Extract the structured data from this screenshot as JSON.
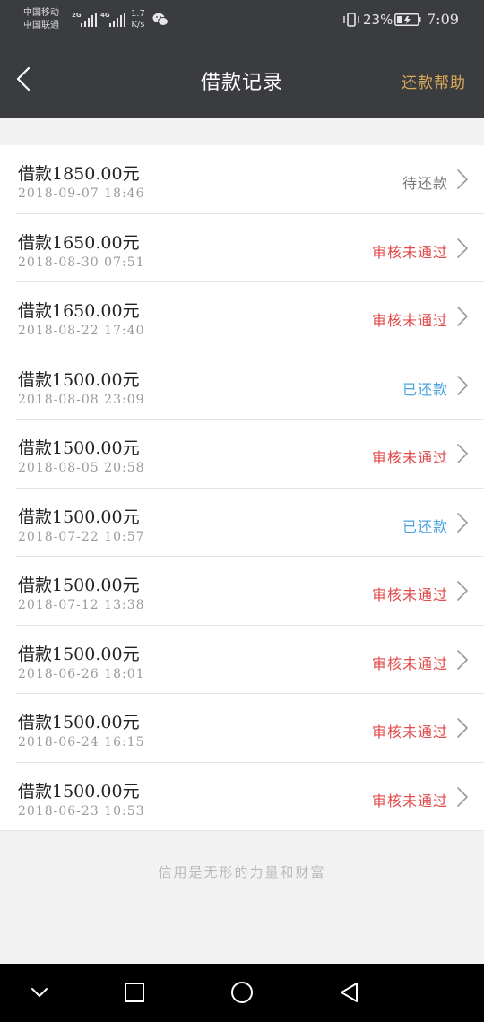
{
  "status_bar": {
    "carrier_1": "中国移动",
    "carrier_2": "中国联通",
    "signal_1_tag": "2G",
    "signal_2_tag": "4G",
    "speed_value": "1.7",
    "speed_unit": "K/s",
    "battery_percent": "23%",
    "time": "7:09"
  },
  "nav": {
    "title": "借款记录",
    "help_label": "还款帮助"
  },
  "colors": {
    "pending": "#7a7a7a",
    "rejected": "#e04a4a",
    "repaid": "#4ba3e0",
    "help_link": "#d9a95a",
    "header_bg": "#3a3c3f"
  },
  "loans": [
    {
      "amount": "借款1850.00元",
      "date": "2018-09-07 18:46",
      "status": "待还款",
      "status_type": "pending"
    },
    {
      "amount": "借款1650.00元",
      "date": "2018-08-30 07:51",
      "status": "审核未通过",
      "status_type": "rejected"
    },
    {
      "amount": "借款1650.00元",
      "date": "2018-08-22 17:40",
      "status": "审核未通过",
      "status_type": "rejected"
    },
    {
      "amount": "借款1500.00元",
      "date": "2018-08-08 23:09",
      "status": "已还款",
      "status_type": "repaid"
    },
    {
      "amount": "借款1500.00元",
      "date": "2018-08-05 20:58",
      "status": "审核未通过",
      "status_type": "rejected"
    },
    {
      "amount": "借款1500.00元",
      "date": "2018-07-22 10:57",
      "status": "已还款",
      "status_type": "repaid"
    },
    {
      "amount": "借款1500.00元",
      "date": "2018-07-12 13:38",
      "status": "审核未通过",
      "status_type": "rejected"
    },
    {
      "amount": "借款1500.00元",
      "date": "2018-06-26 18:01",
      "status": "审核未通过",
      "status_type": "rejected"
    },
    {
      "amount": "借款1500.00元",
      "date": "2018-06-24 16:15",
      "status": "审核未通过",
      "status_type": "rejected"
    },
    {
      "amount": "借款1500.00元",
      "date": "2018-06-23 10:53",
      "status": "审核未通过",
      "status_type": "rejected"
    }
  ],
  "footer": {
    "slogan": "信用是无形的力量和财富"
  },
  "icons": {
    "back": "chevron-left-icon",
    "row_arrow": "chevron-right-icon",
    "wechat": "wechat-icon",
    "vibrate": "vibrate-icon",
    "battery": "battery-charging-icon",
    "sys_back": "triangle-back-icon",
    "sys_home": "circle-home-icon",
    "sys_recent": "square-recent-icon",
    "sys_collapse": "chevron-down-icon"
  }
}
